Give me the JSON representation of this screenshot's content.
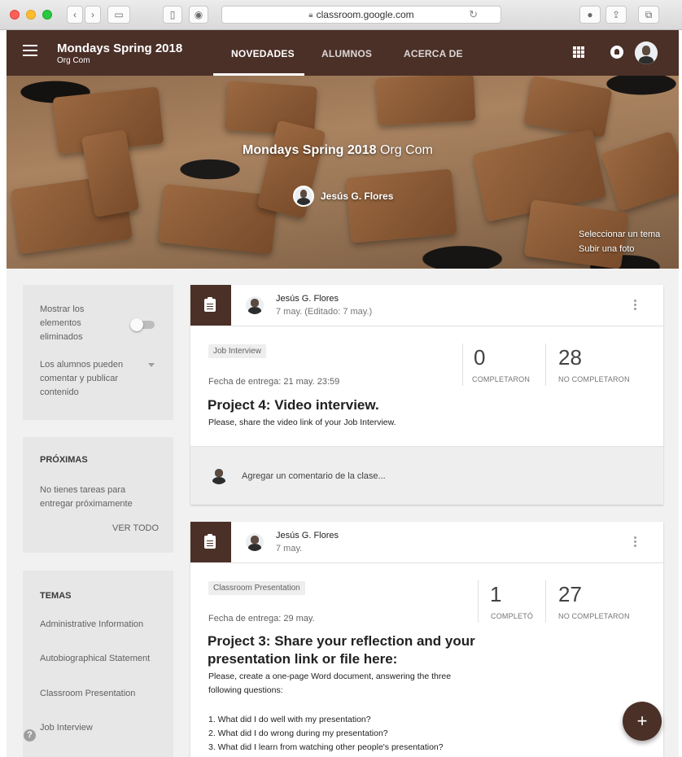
{
  "browser": {
    "url": "classroom.google.com"
  },
  "appbar": {
    "class_name": "Mondays Spring 2018",
    "section": "Org Com",
    "tabs": [
      {
        "label": "NOVEDADES",
        "active": true
      },
      {
        "label": "ALUMNOS",
        "active": false
      },
      {
        "label": "ACERCA DE",
        "active": false
      }
    ],
    "icons": [
      "menu-icon",
      "apps-grid-icon",
      "notifications-icon",
      "user-avatar"
    ]
  },
  "banner": {
    "class_name": "Mondays Spring 2018",
    "section": "Org Com",
    "teacher": "Jesús G. Flores",
    "select_theme": "Seleccionar un tema",
    "upload_photo": "Subir una foto"
  },
  "sidebar": {
    "settings": {
      "show_deleted_label": "Mostrar los elementos eliminados",
      "show_deleted_on": false,
      "student_permission": "Los alumnos pueden comentar y publicar contenido"
    },
    "upcoming": {
      "heading": "PRÓXIMAS",
      "empty_text": "No tienes tareas para entregar próximamente",
      "view_all": "VER TODO"
    },
    "topics": {
      "heading": "TEMAS",
      "items": [
        "Administrative Information",
        "Autobiographical Statement",
        "Classroom Presentation",
        "Job Interview"
      ]
    }
  },
  "posts": [
    {
      "author": "Jesús G. Flores",
      "date": "7 may. (Editado: 7 may.)",
      "topic": "Job Interview",
      "due": "Fecha de entrega: 21 may. 23:59",
      "title": "Project 4: Video interview.",
      "description": "Please, share the video link of your Job Interview.",
      "completed_count": "0",
      "completed_label": "COMPLETARON",
      "not_completed_count": "28",
      "not_completed_label": "NO COMPLETARON",
      "comment_placeholder": "Agregar un comentario de la clase..."
    },
    {
      "author": "Jesús G. Flores",
      "date": "7 may.",
      "topic": "Classroom Presentation",
      "due": "Fecha de entrega: 29 may.",
      "title_line1": "Project 3: Share your reflection and your",
      "title_line2": "presentation link or file here:",
      "desc_line1": "Please, create a one-page Word document, answering the three",
      "desc_line2": "following questions:",
      "q1": "1. What did I do well with my presentation?",
      "q2": "2. What did I do wrong during my presentation?",
      "q3": "3. What did I learn from watching other people's presentation?",
      "completed_count": "1",
      "completed_label": "COMPLETÓ",
      "not_completed_count": "27",
      "not_completed_label": "NO COMPLETARON"
    }
  ],
  "fab": {
    "label": "+"
  },
  "help": {
    "label": "?"
  },
  "colors": {
    "theme": "#4b3028",
    "sidebar_card": "#e7e7e7",
    "page_background": "#f1f1f1"
  }
}
